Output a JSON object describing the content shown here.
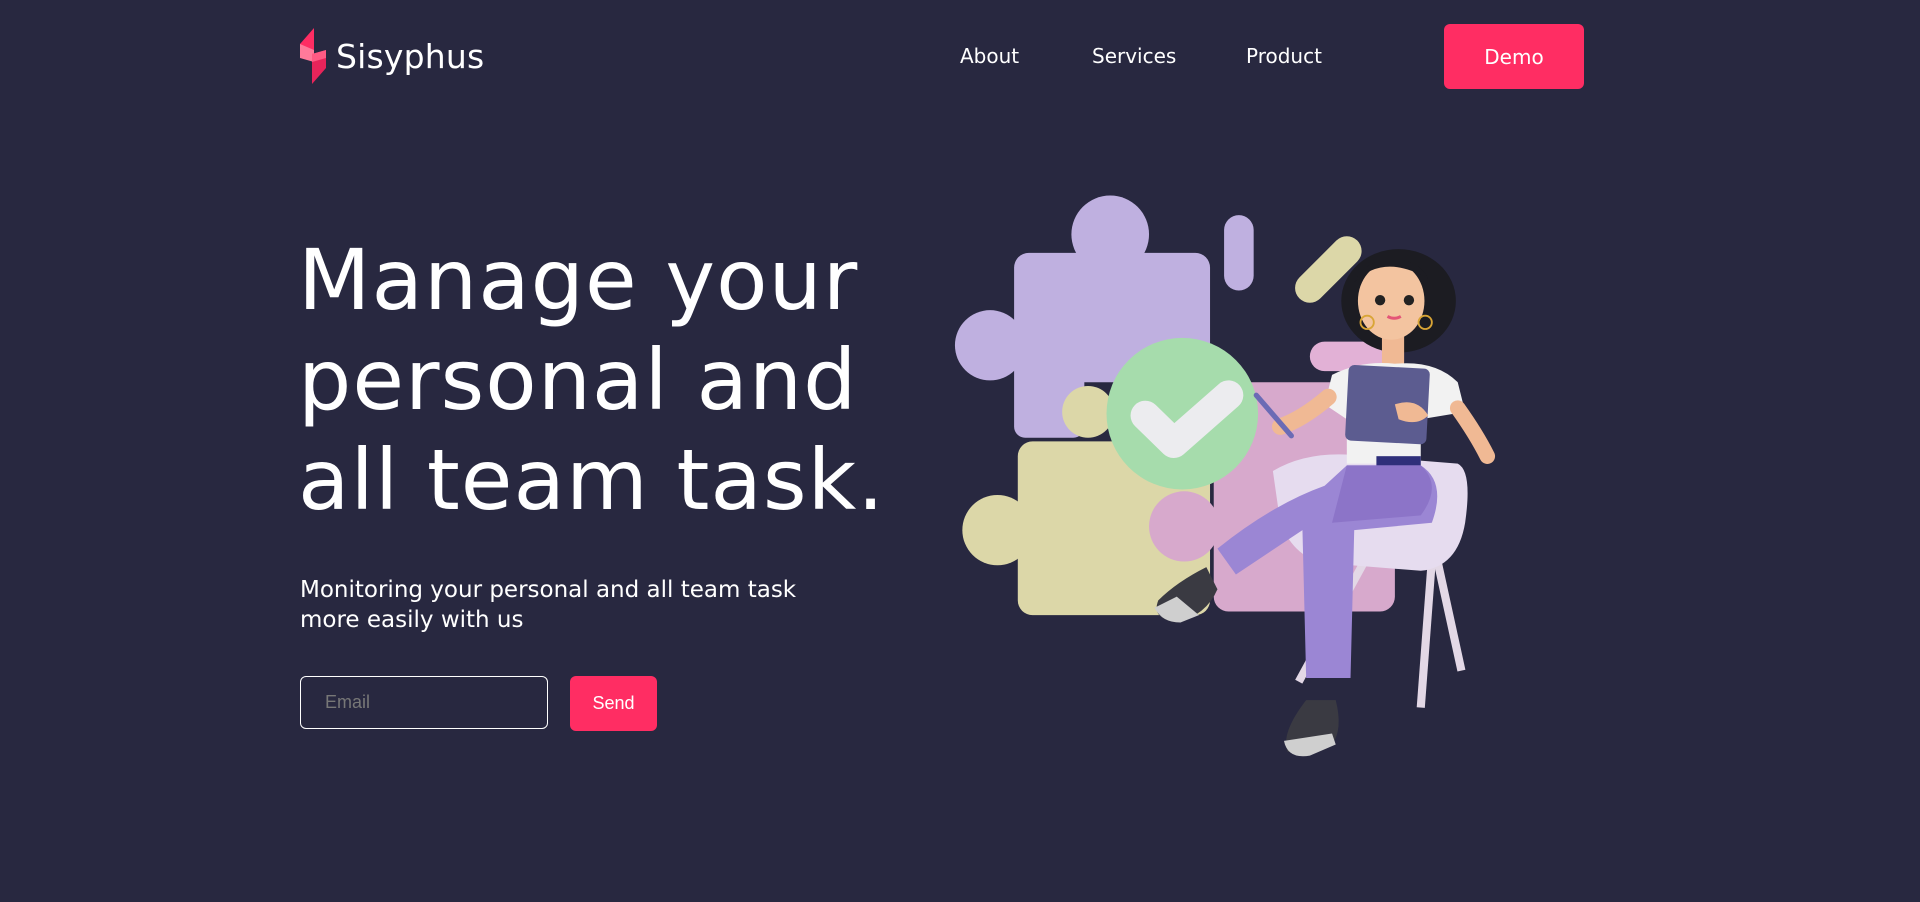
{
  "brand": {
    "name": "Sisyphus",
    "accent": "#ff2d63",
    "background": "#282840"
  },
  "nav": {
    "items": [
      {
        "label": "About"
      },
      {
        "label": "Services"
      },
      {
        "label": "Product"
      }
    ],
    "cta_label": "Demo"
  },
  "hero": {
    "title": "Manage your personal and all team task.",
    "subtitle": "Monitoring your personal and all team task more easily with us",
    "email_placeholder": "Email",
    "email_value": "",
    "send_label": "Send"
  }
}
